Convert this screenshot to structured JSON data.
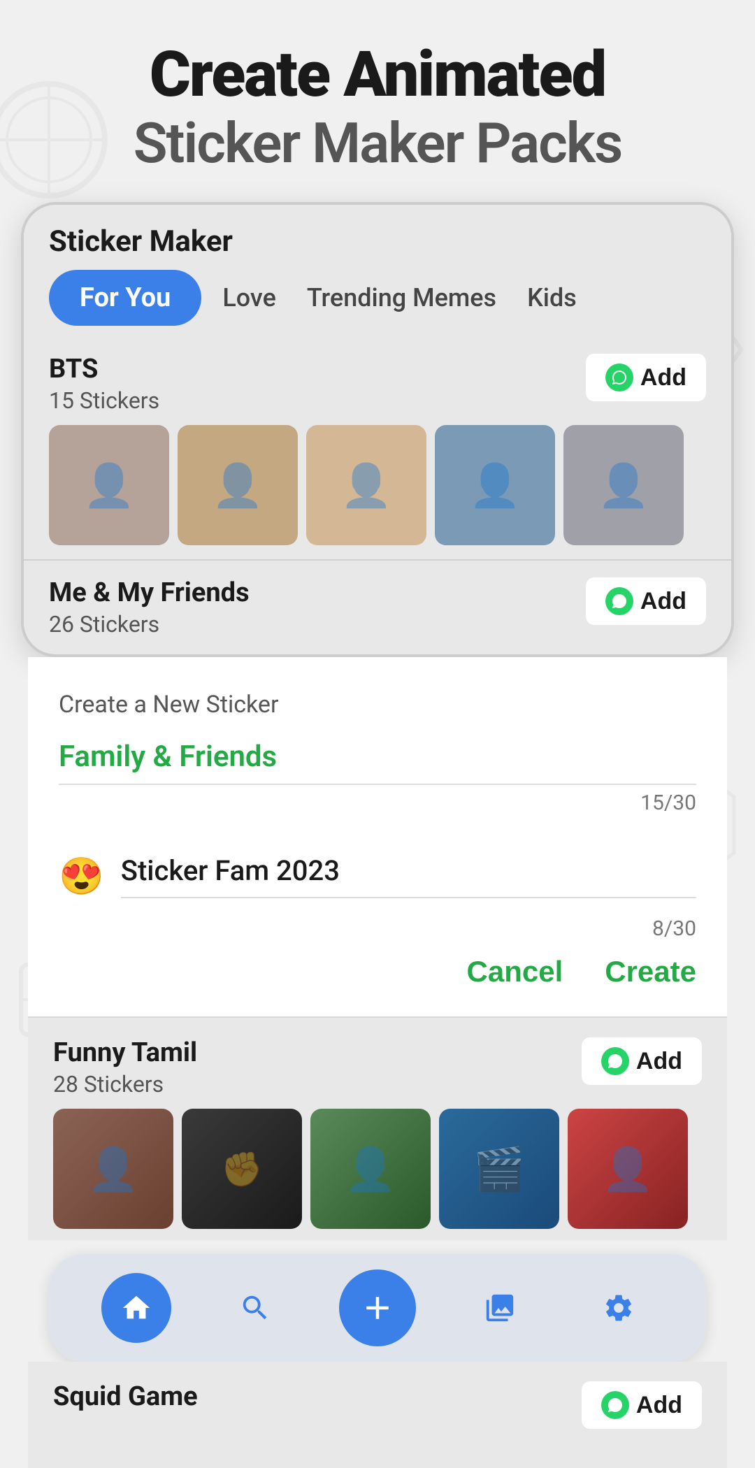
{
  "header": {
    "title_line1": "Create Animated",
    "title_line2": "Sticker Maker Packs"
  },
  "app": {
    "title": "Sticker Maker"
  },
  "tabs": [
    {
      "label": "For You",
      "active": true
    },
    {
      "label": "Love",
      "active": false
    },
    {
      "label": "Trending Memes",
      "active": false
    },
    {
      "label": "Kids",
      "active": false
    }
  ],
  "sticker_packs": [
    {
      "name": "BTS",
      "count": "15 Stickers",
      "add_label": "Add"
    },
    {
      "name": "Me & My Friends",
      "count": "26 Stickers",
      "add_label": "Add"
    },
    {
      "name": "Funny Tamil",
      "count": "28 Stickers",
      "add_label": "Add"
    },
    {
      "name": "Squid Game",
      "count": "",
      "add_label": "Add"
    }
  ],
  "dialog": {
    "hint": "Create a New Sticker",
    "input1": {
      "value": "Family & Friends",
      "counter": "15/30"
    },
    "input2": {
      "emoji": "😍",
      "value": "Sticker Fam 2023",
      "counter": "8/30"
    },
    "cancel_label": "Cancel",
    "create_label": "Create"
  },
  "bottom_nav": {
    "items": [
      {
        "icon": "🏠",
        "label": "home",
        "active": true
      },
      {
        "icon": "🔍",
        "label": "search",
        "active": false
      },
      {
        "icon": "➕",
        "label": "add",
        "active": false
      },
      {
        "icon": "📋",
        "label": "collections",
        "active": false
      },
      {
        "icon": "⚙️",
        "label": "settings",
        "active": false
      }
    ]
  }
}
